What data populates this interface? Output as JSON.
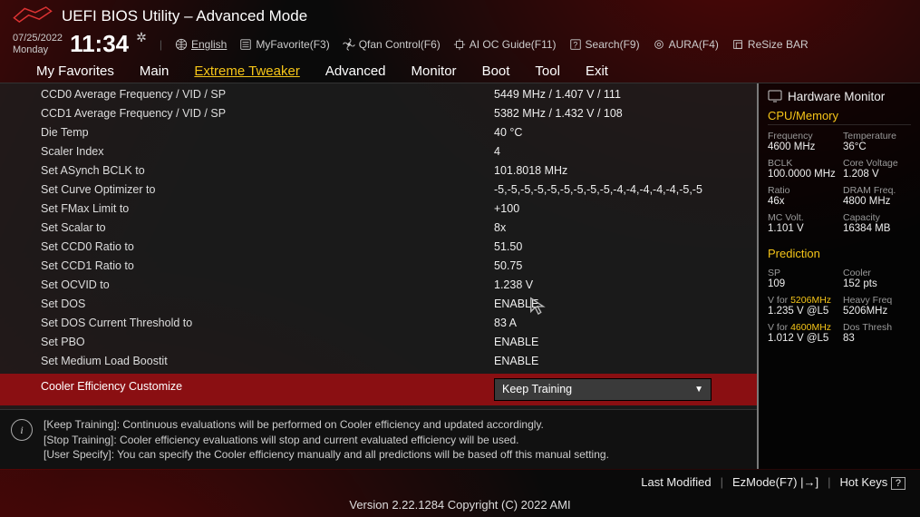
{
  "header": {
    "title": "UEFI BIOS Utility – Advanced Mode",
    "date": "07/25/2022",
    "day": "Monday",
    "time": "11:34",
    "lang": "English",
    "toolbar": [
      {
        "id": "myfav",
        "label": "MyFavorite(F3)"
      },
      {
        "id": "qfan",
        "label": "Qfan Control(F6)"
      },
      {
        "id": "aioc",
        "label": "AI OC Guide(F11)"
      },
      {
        "id": "search",
        "label": "Search(F9)"
      },
      {
        "id": "aura",
        "label": "AURA(F4)"
      },
      {
        "id": "resize",
        "label": "ReSize BAR"
      }
    ]
  },
  "tabs": [
    "My Favorites",
    "Main",
    "Extreme Tweaker",
    "Advanced",
    "Monitor",
    "Boot",
    "Tool",
    "Exit"
  ],
  "active_tab_index": 2,
  "settings": [
    {
      "k": "CCD0 Average Frequency / VID / SP",
      "v": "5449 MHz / 1.407 V / 111"
    },
    {
      "k": "CCD1 Average Frequency / VID / SP",
      "v": "5382 MHz / 1.432 V / 108"
    },
    {
      "k": "Die Temp",
      "v": "40 °C"
    },
    {
      "k": "Scaler Index",
      "v": "4"
    },
    {
      "k": "Set ASynch BCLK to",
      "v": "101.8018 MHz"
    },
    {
      "k": "Set Curve Optimizer to",
      "v": "-5,-5,-5,-5,-5,-5,-5,-5,-5,-4,-4,-4,-4,-4,-5,-5"
    },
    {
      "k": "Set FMax Limit to",
      "v": "+100"
    },
    {
      "k": "Set Scalar to",
      "v": "8x"
    },
    {
      "k": "Set CCD0 Ratio to",
      "v": "51.50"
    },
    {
      "k": "Set CCD1 Ratio to",
      "v": "50.75"
    },
    {
      "k": "Set OCVID to",
      "v": "1.238 V"
    },
    {
      "k": "Set DOS",
      "v": "ENABLE"
    },
    {
      "k": "Set DOS Current Threshold to",
      "v": "83 A"
    },
    {
      "k": "Set PBO",
      "v": "ENABLE"
    },
    {
      "k": "Set Medium Load Boostit",
      "v": "ENABLE"
    }
  ],
  "selected": {
    "k": "Cooler Efficiency Customize",
    "v": "Keep Training"
  },
  "info_lines": [
    "[Keep Training]: Continuous evaluations will be performed on Cooler efficiency and updated accordingly.",
    "[Stop Training]: Cooler efficiency evaluations will stop and current evaluated efficiency will be used.",
    "[User Specify]: You can specify the Cooler efficiency manually and all predictions will be based off this manual setting."
  ],
  "hw": {
    "title": "Hardware Monitor",
    "cpu_section": "CPU/Memory",
    "rows1": [
      {
        "a_k": "Frequency",
        "a_v": "4600 MHz",
        "b_k": "Temperature",
        "b_v": "36°C"
      },
      {
        "a_k": "BCLK",
        "a_v": "100.0000 MHz",
        "b_k": "Core Voltage",
        "b_v": "1.208 V"
      },
      {
        "a_k": "Ratio",
        "a_v": "46x",
        "b_k": "DRAM Freq.",
        "b_v": "4800 MHz"
      },
      {
        "a_k": "MC Volt.",
        "a_v": "1.101 V",
        "b_k": "Capacity",
        "b_v": "16384 MB"
      }
    ],
    "pred_section": "Prediction",
    "pred": [
      {
        "a_k": "SP",
        "a_v": "109",
        "b_k": "Cooler",
        "b_v": "152 pts"
      }
    ],
    "pred2_label_pre": "V for ",
    "pred2_hl": "5206MHz",
    "pred2_b": "Heavy Freq",
    "pred2_av": "1.235 V @L5",
    "pred2_bv": "5206MHz",
    "pred3_label_pre": "V for ",
    "pred3_hl": "4600MHz",
    "pred3_b": "Dos Thresh",
    "pred3_av": "1.012 V @L5",
    "pred3_bv": "83"
  },
  "footer": {
    "last": "Last Modified",
    "ez": "EzMode(F7)",
    "hot": "Hot Keys",
    "q": "?"
  },
  "version": "Version 2.22.1284 Copyright (C) 2022 AMI"
}
